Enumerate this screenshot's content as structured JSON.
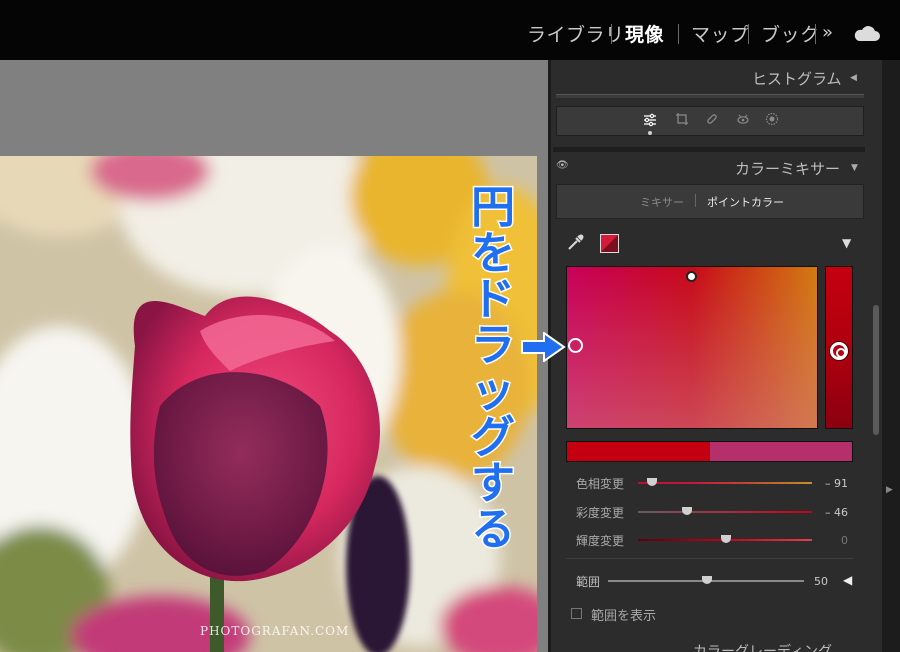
{
  "top_nav": {
    "modules": [
      "ライブラリ",
      "現像",
      "マップ",
      "ブック"
    ],
    "active_module": "現像",
    "more_icon": "double-chevron-right-icon",
    "cloud_icon": "cloud-icon"
  },
  "panel": {
    "histogram_header": "ヒストグラム",
    "tools": [
      "sliders-icon",
      "crop-icon",
      "healing-brush-icon",
      "red-eye-icon",
      "masking-icon"
    ],
    "color_mixer_header": "カラーミキサー",
    "tabs": [
      "ミキサー",
      "ポイントカラー"
    ],
    "active_tab": "ポイントカラー",
    "point_color": {
      "eyedropper_icon": "eyedropper-icon",
      "swatch_color": "#d41b3a",
      "field_colors": {
        "left": "#c8005a",
        "mid": "#c70a18",
        "right": "#d37a10"
      },
      "before_color": "#c40010",
      "after_color": "#b52f6a"
    },
    "sliders": [
      {
        "label": "色相変更",
        "value": "– 91",
        "position": -0.91
      },
      {
        "label": "彩度変更",
        "value": "– 46",
        "position": -0.46
      },
      {
        "label": "輝度変更",
        "value": "0",
        "position": 0
      }
    ],
    "range": {
      "label": "範囲",
      "value": "50"
    },
    "show_range_label": "範囲を表示",
    "next_panel_label": "カラーグレーディング"
  },
  "photo": {
    "watermark": "PHOTOGRAFAN.COM"
  },
  "annotation": {
    "text": "円をドラッグする",
    "color": "#1f6ff0"
  }
}
